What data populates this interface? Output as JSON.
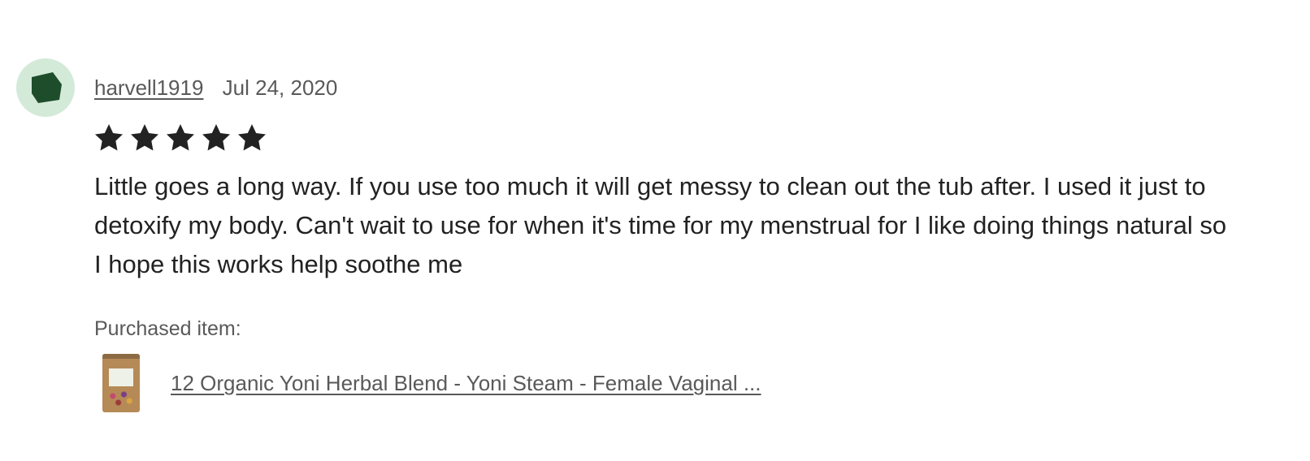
{
  "review": {
    "username": "harvell1919",
    "date": "Jul 24, 2020",
    "rating": 5,
    "rating_max": 5,
    "text": "Little goes a long way. If you use too much it will get messy to clean out the tub after. I used it just to detoxify my body. Can't wait to use for when it's time for my menstrual for I like doing things natural so I hope this works help soothe me",
    "purchased_label": "Purchased item:",
    "product_title": "12 Organic Yoni Herbal Blend - Yoni Steam - Female Vaginal ..."
  },
  "colors": {
    "avatar_bg": "#d4ead9",
    "avatar_fg": "#1e4d2b",
    "star": "#222222",
    "muted_text": "#595959"
  },
  "icons": {
    "avatar": "pentagon-avatar-icon",
    "star": "star-icon",
    "product_thumb": "product-bag-thumbnail"
  }
}
